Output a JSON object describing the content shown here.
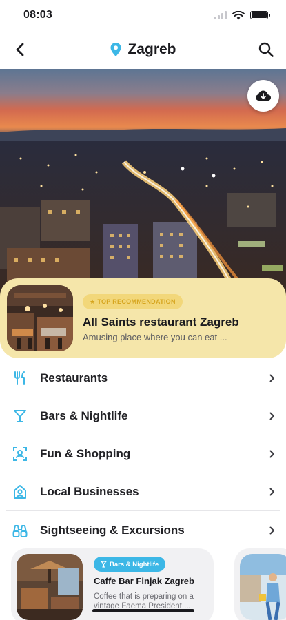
{
  "status_bar": {
    "time": "08:03"
  },
  "nav": {
    "title": "Zagreb",
    "back_icon": "back-arrow-icon",
    "search_icon": "search-icon",
    "location_icon": "location-pin-icon"
  },
  "hero": {
    "download_icon": "cloud-download-icon"
  },
  "recommendation": {
    "badge": "TOP RECOMMENDATION",
    "title": "All Saints restaurant Zagreb",
    "description": "Amusing place where you can eat ..."
  },
  "categories": [
    {
      "label": "Restaurants",
      "icon": "cutlery-icon"
    },
    {
      "label": "Bars & Nightlife",
      "icon": "cocktail-icon"
    },
    {
      "label": "Fun & Shopping",
      "icon": "shopping-icon"
    },
    {
      "label": "Local Businesses",
      "icon": "store-icon"
    },
    {
      "label": "Sightseeing & Excursions",
      "icon": "binoculars-icon"
    }
  ],
  "place_cards": [
    {
      "badge": "Bars & Nightlife",
      "title": "Caffe Bar Finjak Zagreb",
      "description": "Coffee that is preparing on a vintage Faema President ..."
    }
  ],
  "colors": {
    "accent": "#3cb7e6",
    "recommendation_bg": "#f5e6aa",
    "badge_text": "#d6a51f"
  }
}
